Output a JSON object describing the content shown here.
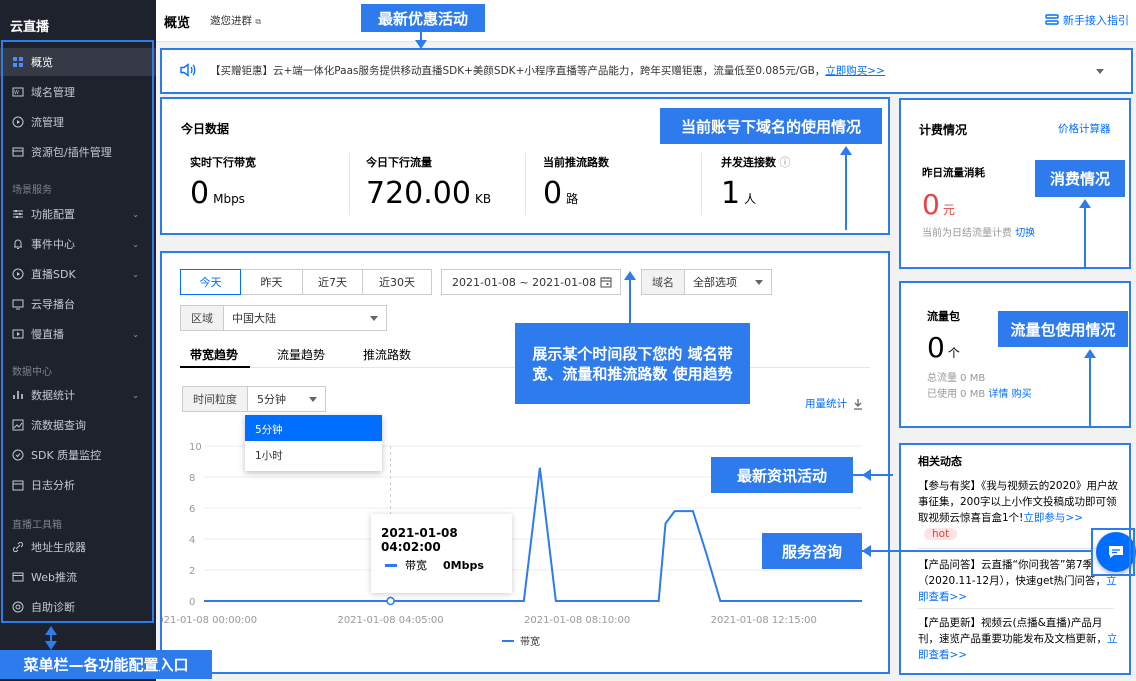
{
  "app": {
    "name": "云直播"
  },
  "sidebar": {
    "items": [
      {
        "label": "概览",
        "icon": "grid-icon"
      },
      {
        "label": "域名管理",
        "icon": "www-icon"
      },
      {
        "label": "流管理",
        "icon": "play-circle-icon"
      },
      {
        "label": "资源包/插件管理",
        "icon": "package-icon"
      },
      {
        "label": "功能配置",
        "icon": "sliders-icon"
      },
      {
        "label": "事件中心",
        "icon": "bell-icon"
      },
      {
        "label": "直播SDK",
        "icon": "play-box-icon"
      },
      {
        "label": "云导播台",
        "icon": "monitor-icon"
      },
      {
        "label": "慢直播",
        "icon": "slow-live-icon"
      },
      {
        "label": "数据统计",
        "icon": "bar-chart-icon"
      },
      {
        "label": "流数据查询",
        "icon": "line-chart-icon"
      },
      {
        "label": "SDK 质量监控",
        "icon": "monitor-check-icon"
      },
      {
        "label": "日志分析",
        "icon": "calendar-icon"
      },
      {
        "label": "地址生成器",
        "icon": "link-icon"
      },
      {
        "label": "Web推流",
        "icon": "web-icon"
      },
      {
        "label": "自助诊断",
        "icon": "diagnose-icon"
      }
    ],
    "groups": [
      "场景服务",
      "数据中心",
      "直播工具箱"
    ]
  },
  "header": {
    "title": "概览",
    "invite": "邀您进群",
    "guide": "新手接入指引"
  },
  "notice": {
    "text": "【买赠钜惠】云+端一体化Paas服务提供移动直播SDK+美颜SDK+小程序直播等产品能力，跨年买赠钜惠，流量低至0.085元/GB，",
    "link": "立即购买>>"
  },
  "today": {
    "title": "今日数据",
    "stats": [
      {
        "label": "实时下行带宽",
        "value": "0",
        "unit": "Mbps"
      },
      {
        "label": "今日下行流量",
        "value": "720.00",
        "unit": "KB"
      },
      {
        "label": "当前推流路数",
        "value": "0",
        "unit": "路"
      },
      {
        "label": "并发连接数",
        "value": "1",
        "unit": "人"
      }
    ]
  },
  "billing": {
    "title": "计费情况",
    "calc": "价格计算器",
    "sub": "昨日流量消耗",
    "value": "0",
    "unit": "元",
    "note": "当前为日结流量计费",
    "switch": "切换"
  },
  "traffic_pkg": {
    "title": "流量包",
    "value": "0",
    "unit": "个",
    "total": "总流量 0 MB",
    "used": "已使用 0 MB",
    "detail": "详情",
    "buy": "购买"
  },
  "filters": {
    "range_tabs": [
      "今天",
      "昨天",
      "近7天",
      "近30天"
    ],
    "date_range": "2021-01-08 ~ 2021-01-08",
    "domain_label": "域名",
    "domain_value": "全部选项",
    "region_label": "区域",
    "region_value": "中国大陆"
  },
  "chart_tabs": [
    "带宽趋势",
    "流量趋势",
    "推流路数"
  ],
  "granularity": {
    "label": "时间粒度",
    "value": "5分钟",
    "options": [
      "5分钟",
      "1小时"
    ]
  },
  "usage_stats": "用量统计",
  "tooltip": {
    "time": "2021-01-08 04:02:00",
    "series": "带宽",
    "value": "0Mbps"
  },
  "chart_data": {
    "type": "line",
    "x_ticks": [
      "2021-01-08 00:00:00",
      "2021-01-08 04:05:00",
      "2021-01-08 08:10:00",
      "2021-01-08 12:15:00"
    ],
    "y_ticks": [
      "10",
      "8",
      "6",
      "4",
      "2",
      "0"
    ],
    "ylim": [
      0,
      10
    ],
    "xlim_hours": [
      0,
      14.4
    ],
    "series": [
      {
        "name": "带宽",
        "color": "#2d7bed",
        "points": [
          [
            0,
            0
          ],
          [
            7.0,
            0
          ],
          [
            7.35,
            8.6
          ],
          [
            7.7,
            0
          ],
          [
            9.95,
            0
          ],
          [
            10.1,
            5.0
          ],
          [
            10.3,
            5.8
          ],
          [
            10.7,
            5.8
          ],
          [
            11.0,
            3.0
          ],
          [
            11.3,
            0
          ],
          [
            14.4,
            0
          ]
        ]
      }
    ],
    "legend": "bottom"
  },
  "news": {
    "title": "相关动态",
    "items": [
      {
        "text": "【参与有奖】《我与视频云的2020》用户故事征集，200字以上小作文投稿成功即可领取视频云惊喜盲盒1个!",
        "link": "立即参与>>",
        "badge": "hot"
      },
      {
        "text": "【产品问答】云直播“你问我答”第7季（2020.11-12月），快速get热门问答，",
        "link": "立即查看>>"
      },
      {
        "text": "【产品更新】视频云(点播&直播)产品月刊，速览产品重要功能发布及文档更新，",
        "link": "立即查看>>"
      }
    ]
  },
  "annotations": {
    "menu": "菜单栏—各功能配置入口",
    "promo": "最新优惠活动",
    "domain_usage": "当前账号下域名的使用情况",
    "consumption": "消费情况",
    "traffic_pkg": "流量包使用情况",
    "trend": "展示某个时间段下您的 域名带宽、流量和推流路数 使用趋势",
    "news": "最新资讯活动",
    "service": "服务咨询"
  }
}
